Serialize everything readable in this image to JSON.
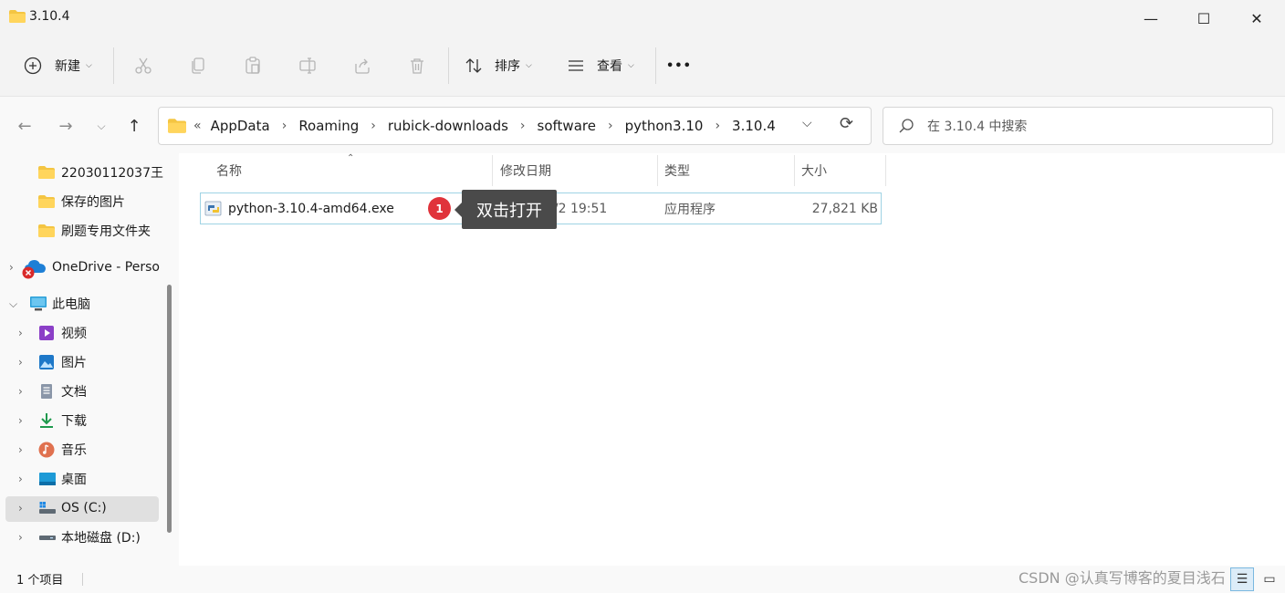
{
  "window": {
    "title": "3.10.4",
    "minimize_icon": "—",
    "maximize_icon": "☐",
    "close_icon": "✕"
  },
  "toolbar": {
    "new_label": "新建",
    "sort_label": "排序",
    "view_label": "查看",
    "more_label": "•••"
  },
  "breadcrumb": {
    "prefix": "«",
    "items": [
      "AppData",
      "Roaming",
      "rubick-downloads",
      "software",
      "python3.10",
      "3.10.4"
    ]
  },
  "search": {
    "placeholder": "在 3.10.4 中搜索"
  },
  "sidebar": {
    "items": [
      {
        "label": "22030112037王",
        "icon": "folder-icon"
      },
      {
        "label": "保存的图片",
        "icon": "folder-icon"
      },
      {
        "label": "刷题专用文件夹",
        "icon": "folder-icon"
      },
      {
        "label": "OneDrive - Perso",
        "icon": "onedrive-icon"
      },
      {
        "label": "此电脑",
        "icon": "computer-icon"
      },
      {
        "label": "视频",
        "icon": "video-icon"
      },
      {
        "label": "图片",
        "icon": "pictures-icon"
      },
      {
        "label": "文档",
        "icon": "documents-icon"
      },
      {
        "label": "下载",
        "icon": "downloads-icon"
      },
      {
        "label": "音乐",
        "icon": "music-icon"
      },
      {
        "label": "桌面",
        "icon": "desktop-icon"
      },
      {
        "label": "OS (C:)",
        "icon": "drive-c-icon"
      },
      {
        "label": "本地磁盘 (D:)",
        "icon": "drive-d-icon"
      }
    ]
  },
  "columns": {
    "name": "名称",
    "modified": "修改日期",
    "type": "类型",
    "size": "大小"
  },
  "files": [
    {
      "name": "python-3.10.4-amd64.exe",
      "modified": "2/2 19:51",
      "type": "应用程序",
      "size": "27,821 KB"
    }
  ],
  "annotation": {
    "number": "1",
    "text": "双击打开"
  },
  "status": {
    "item_count": "1 个项目",
    "watermark": "CSDN @认真写博客的夏目浅石"
  },
  "colors": {
    "folder": "#f4c542",
    "accent": "#0078d4",
    "badge": "#e0333b",
    "tooltip": "#4a4a4a"
  }
}
